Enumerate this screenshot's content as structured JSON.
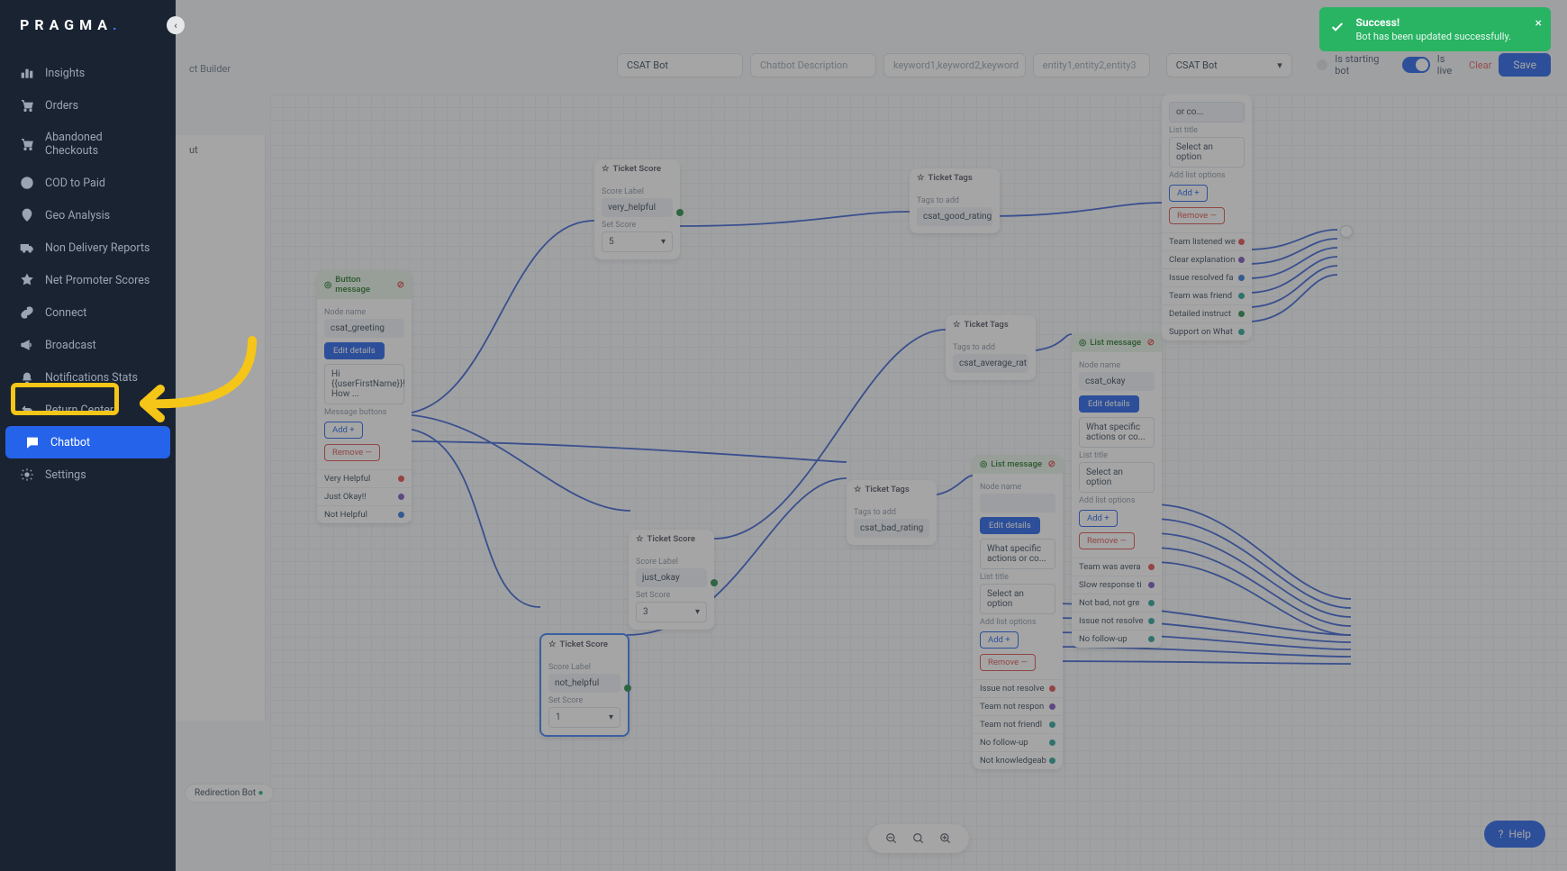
{
  "brand": {
    "name": "PRAGMA",
    "dot": "."
  },
  "sidebar": {
    "items": [
      {
        "label": "Insights",
        "icon": "chart"
      },
      {
        "label": "Orders",
        "icon": "cart"
      },
      {
        "label": "Abandoned Checkouts",
        "icon": "cart-x"
      },
      {
        "label": "COD to Paid",
        "icon": "dollar"
      },
      {
        "label": "Geo Analysis",
        "icon": "pin"
      },
      {
        "label": "Non Delivery Reports",
        "icon": "truck"
      },
      {
        "label": "Net Promoter Scores",
        "icon": "star"
      },
      {
        "label": "Connect",
        "icon": "link"
      },
      {
        "label": "Broadcast",
        "icon": "megaphone"
      },
      {
        "label": "Notifications Stats",
        "icon": "bell"
      },
      {
        "label": "Return Center",
        "icon": "return"
      },
      {
        "label": "Chatbot",
        "icon": "chat",
        "active": true
      },
      {
        "label": "Settings",
        "icon": "gear",
        "highlighted": true
      }
    ]
  },
  "topbar": {
    "botNameValue": "CSAT Bot",
    "descriptionPlaceholder": "Chatbot Description",
    "keywordsPlaceholder": "keyword1,keyword2,keyword",
    "entitiesPlaceholder": "entity1,entity2,entity3",
    "selectValue": "CSAT Bot",
    "startingLabel": "Is starting bot",
    "liveLabel": "Is live",
    "clearLabel": "Clear",
    "saveLabel": "Save",
    "liveBadge": "Live"
  },
  "breadcrumb": "ct Builder",
  "toast": {
    "title": "Success!",
    "sub": "Bot has been updated successfully."
  },
  "leftPanelPeek": {
    "section": "ut",
    "pill": "Redirection Bot"
  },
  "nodes": {
    "btnMsg": {
      "title": "Button message",
      "nodeName": "csat_greeting",
      "editBtn": "Edit details",
      "preview": "Hi {{userFirstName}}! How ...",
      "msgBtnsLabel": "Message buttons",
      "addBtn": "Add +",
      "removeBtn": "Remove —",
      "options": [
        "Very Helpful",
        "Just Okay!!",
        "Not Helpful"
      ],
      "labels": {
        "nodeName": "Node name"
      }
    },
    "ticketScore1": {
      "title": "Ticket Score",
      "labelLabel": "Score Label",
      "labelValue": "very_helpful",
      "scoreLabel": "Set Score",
      "scoreValue": "5"
    },
    "ticketScore2": {
      "title": "Ticket Score",
      "labelLabel": "Score Label",
      "labelValue": "just_okay",
      "scoreLabel": "Set Score",
      "scoreValue": "3"
    },
    "ticketScore3": {
      "title": "Ticket Score",
      "labelLabel": "Score Label",
      "labelValue": "not_helpful",
      "scoreLabel": "Set Score",
      "scoreValue": "1"
    },
    "ticketTags1": {
      "title": "Ticket Tags",
      "tagsLabel": "Tags to add",
      "tagValue": "csat_good_rating"
    },
    "ticketTags2": {
      "title": "Ticket Tags",
      "tagsLabel": "Tags to add",
      "tagValue": "csat_average_rat"
    },
    "ticketTags3": {
      "title": "Ticket Tags",
      "tagsLabel": "Tags to add",
      "tagValue": "csat_bad_rating"
    },
    "listMsg1": {
      "title": "List message",
      "nodeNameLabel": "Node name",
      "nodeName": "csat_okay",
      "editBtn": "Edit details",
      "preview": "What specific actions or co...",
      "listTitleLabel": "List title",
      "selectPlaceholder": "Select an option",
      "addOptLabel": "Add list options",
      "addBtn": "Add +",
      "removeBtn": "Remove —",
      "options": [
        "Team was avera",
        "Slow response ti",
        "Not bad, not gre",
        "Issue not resolve",
        "No follow-up"
      ]
    },
    "listMsg2": {
      "title": "List message",
      "nodeNameLabel": "Node name",
      "nodeName": "",
      "editBtn": "Edit details",
      "preview": "What specific actions or co...",
      "listTitleLabel": "List title",
      "selectPlaceholder": "Select an option",
      "addOptLabel": "Add list options",
      "addBtn": "Add +",
      "removeBtn": "Remove —",
      "options": [
        "Issue not resolve",
        "Team not respon",
        "Team not friendl",
        "No follow-up",
        "Not knowledgeab"
      ]
    },
    "listMsgTop": {
      "listTitleLabel": "List title",
      "selectPlaceholder": "Select an option",
      "addOptLabel": "Add list options",
      "addBtn": "Add +",
      "removeBtn": "Remove —",
      "options": [
        "Team listened we",
        "Clear explanation",
        "Issue resolved fa",
        "Team was friend",
        "Detailed instruct",
        "Support on What"
      ]
    }
  },
  "zoom": {
    "minus": "−",
    "reset": "⊙",
    "plus": "+"
  },
  "help": "Help"
}
